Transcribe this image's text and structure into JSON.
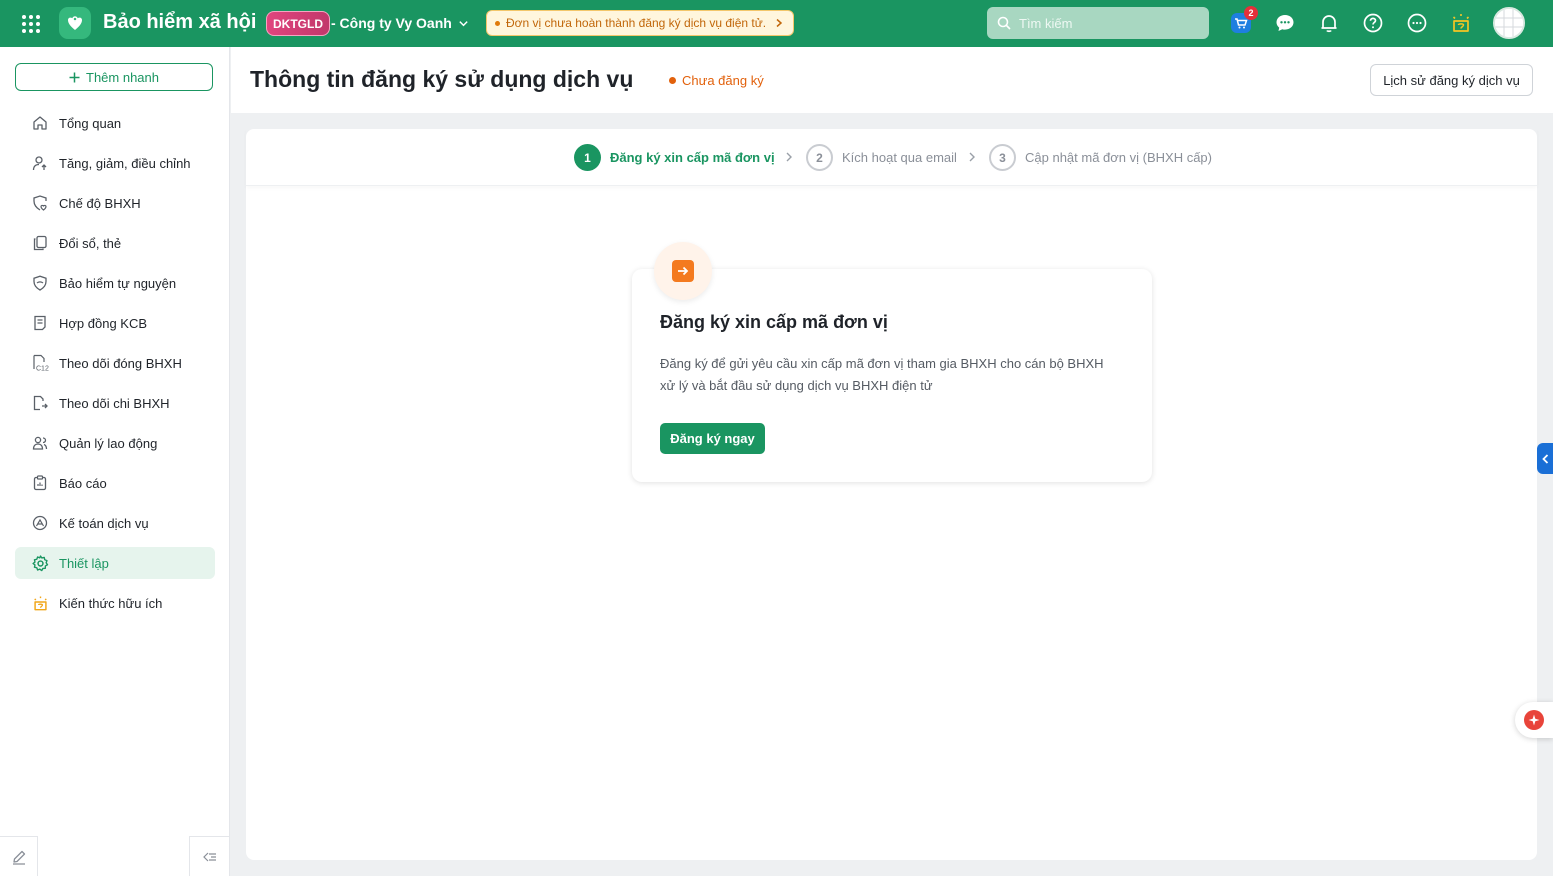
{
  "topbar": {
    "app_title": "Bảo hiểm xã hội",
    "org_code": "DKTGLD",
    "org_name": "- Công ty Vy Oanh",
    "alert_text": "Đơn vị chưa hoàn thành đăng ký dịch vụ điện tử.",
    "search_placeholder": "Tìm kiếm",
    "cart_count": "2",
    "icons": [
      "apps-grid-icon",
      "cart-icon",
      "chat-icon",
      "bell-icon",
      "help-icon",
      "more-icon",
      "idea-icon"
    ]
  },
  "sidebar": {
    "quick_add_label": "Thêm nhanh",
    "items": [
      {
        "label": "Tổng quan",
        "icon": "home-icon"
      },
      {
        "label": "Tăng, giảm, điều chỉnh",
        "icon": "user-adjust-icon"
      },
      {
        "label": "Chế độ BHXH",
        "icon": "heart-shield-icon"
      },
      {
        "label": "Đổi sổ, thẻ",
        "icon": "copy-card-icon"
      },
      {
        "label": "Bảo hiểm tự nguyện",
        "icon": "shield-icon"
      },
      {
        "label": "Hợp đồng KCB",
        "icon": "contract-icon"
      },
      {
        "label": "Theo dõi đóng BHXH",
        "icon": "c12-doc-icon"
      },
      {
        "label": "Theo dõi chi BHXH",
        "icon": "payout-doc-icon"
      },
      {
        "label": "Quản lý lao động",
        "icon": "people-icon"
      },
      {
        "label": "Báo cáo",
        "icon": "report-icon"
      },
      {
        "label": "Kế toán dịch vụ",
        "icon": "accounting-icon"
      },
      {
        "label": "Thiết lập",
        "icon": "gear-icon",
        "active": true
      },
      {
        "label": "Kiến thức hữu ích",
        "icon": "bulb-icon"
      }
    ]
  },
  "header": {
    "title": "Thông tin đăng ký sử dụng dịch vụ",
    "status": "Chưa đăng ký",
    "history_button": "Lịch sử đăng ký dịch vụ"
  },
  "steps": [
    {
      "num": "1",
      "label": "Đăng ký xin cấp mã đơn vị",
      "state": "current"
    },
    {
      "num": "2",
      "label": "Kích hoạt qua email",
      "state": "todo"
    },
    {
      "num": "3",
      "label": "Cập nhật mã đơn vị (BHXH cấp)",
      "state": "todo"
    }
  ],
  "register_card": {
    "title": "Đăng ký xin cấp mã đơn vị",
    "description": "Đăng ký để gửi yêu cầu xin cấp mã đơn vị tham gia BHXH cho cán bộ BHXH xử lý và bắt đầu sử dụng dịch vụ BHXH điện tử",
    "button": "Đăng ký ngay"
  },
  "colors": {
    "brand": "#1a9561",
    "warning": "#e2610c",
    "accent_orange": "#f47a1f"
  }
}
